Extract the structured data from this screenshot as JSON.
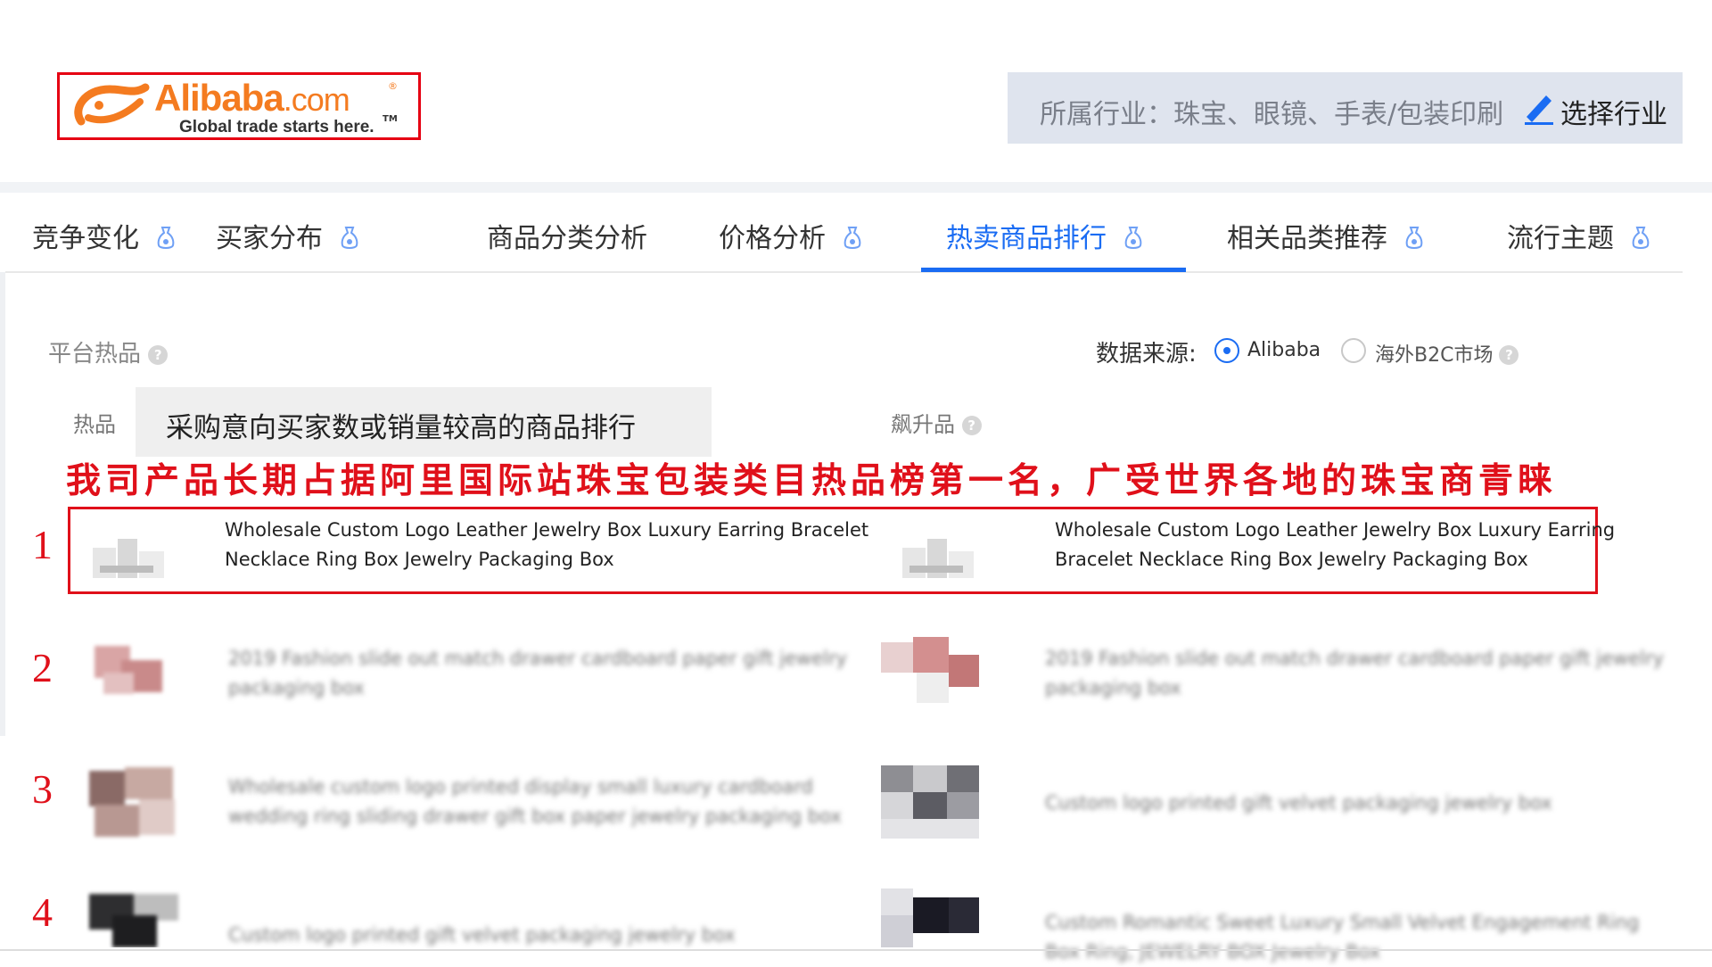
{
  "logo": {
    "brand": "Alibaba",
    "domain": ".com",
    "registered": "®",
    "tagline": "Global trade starts here.",
    "tm": "TM",
    "color": "#f47b20"
  },
  "industry": {
    "label": "所属行业：珠宝、眼镜、手表/包装印刷",
    "select_label": "选择行业",
    "icon": "edit-pen-icon"
  },
  "tabs": [
    {
      "label": "竞争变化",
      "icon": "money-bag-icon"
    },
    {
      "label": "买家分布",
      "icon": "money-bag-icon"
    },
    {
      "label": "商品分类分析"
    },
    {
      "label": "价格分析",
      "icon": "money-bag-icon"
    },
    {
      "label": "热卖商品排行",
      "icon": "money-bag-icon",
      "active": true
    },
    {
      "label": "相关品类推荐",
      "icon": "money-bag-icon"
    },
    {
      "label": "流行主题",
      "icon": "money-bag-icon"
    }
  ],
  "section": {
    "title": "平台热品",
    "help": "?",
    "source_label": "数据来源:",
    "sources": [
      {
        "label": "Alibaba",
        "selected": true
      },
      {
        "label": "海外B2C市场",
        "selected": false
      }
    ],
    "hot_label": "热品",
    "rising_label": "飙升品",
    "tooltip": "采购意向买家数或销量较高的商品排行"
  },
  "caption": "我司产品长期占据阿里国际站珠宝包装类目热品榜第一名，广受世界各地的珠宝商青睐",
  "accent_colors": {
    "blue": "#1a6cf3",
    "red": "#e0101a"
  },
  "rows": [
    {
      "rank": "1",
      "left": {
        "line1": "Wholesale Custom Logo Leather Jewelry Box Luxury Earring Bracelet",
        "line2": "Necklace Ring Box Jewelry Packaging Box"
      },
      "right": {
        "line1": "Wholesale Custom Logo Leather Jewelry Box Luxury Earring",
        "line2": "Bracelet Necklace Ring Box Jewelry Packaging Box"
      }
    },
    {
      "rank": "2",
      "left": {
        "line1": "2019 Fashion slide out match drawer cardboard paper gift jewelry",
        "line2": "packaging box"
      },
      "right": {
        "line1": "2019 Fashion slide out match drawer cardboard paper gift jewelry",
        "line2": "packaging box"
      }
    },
    {
      "rank": "3",
      "left": {
        "line1": "Wholesale custom logo printed display small luxury cardboard",
        "line2": "wedding ring sliding drawer gift box paper jewelry packaging box"
      },
      "right": {
        "line1": "Custom logo printed gift velvet packaging jewelry box",
        "line2": ""
      }
    },
    {
      "rank": "4",
      "left": {
        "line1": "Custom logo printed gift velvet packaging jewelry box",
        "line2": ""
      },
      "right": {
        "line1": "Custom Romantic Sweet Luxury Small Velvet Engagement Ring",
        "line2": "Box Ring, JEWELRY BOX Jewelry Box"
      }
    }
  ]
}
